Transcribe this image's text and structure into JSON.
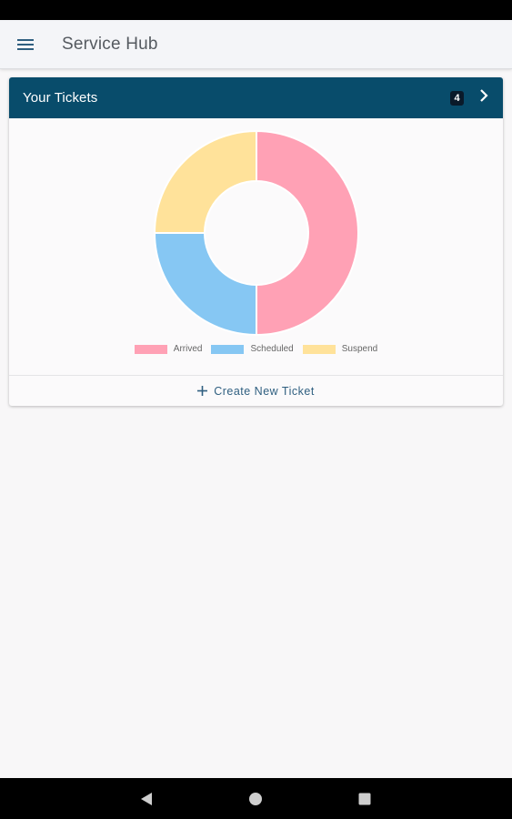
{
  "app_bar": {
    "title": "Service Hub",
    "menu_icon": "hamburger-menu-icon"
  },
  "tickets_card": {
    "title": "Your Tickets",
    "count": "4",
    "chevron_icon": "chevron-right-icon",
    "create_label": "Create New Ticket",
    "create_icon": "plus-icon"
  },
  "chart_data": {
    "type": "pie",
    "variant": "doughnut",
    "title": "",
    "categories": [
      "Arrived",
      "Scheduled",
      "Suspend"
    ],
    "values": [
      2,
      1,
      1
    ],
    "colors": [
      "#ffa1b5",
      "#86c7f3",
      "#ffe29a"
    ],
    "legend_position": "bottom"
  },
  "nav_bar": {
    "back_icon": "back-triangle-icon",
    "home_icon": "home-circle-icon",
    "recents_icon": "recents-square-icon"
  }
}
